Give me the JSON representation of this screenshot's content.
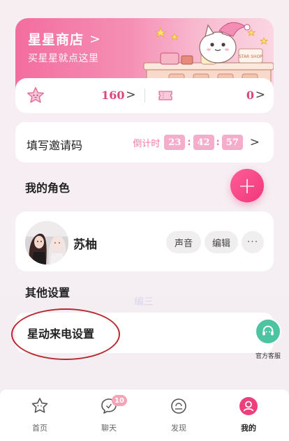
{
  "shop": {
    "title": "星星商店",
    "chevron": ">",
    "subtitle": "买星星就点这里",
    "sign_text": "STAR SHOP"
  },
  "stats": {
    "stars": "160",
    "tickets": "0",
    "arrow": ">"
  },
  "invite": {
    "label": "填写邀请码",
    "countdown_label": "倒计时",
    "hours": "23",
    "minutes": "42",
    "seconds": "57",
    "separator": ":",
    "arrow": ">"
  },
  "roles": {
    "section_title": "我的角色",
    "add_label": "+",
    "items": [
      {
        "name": "苏柚",
        "voice_label": "声音",
        "edit_label": "编辑",
        "more_label": "···"
      }
    ]
  },
  "other": {
    "section_title": "其他设置",
    "call_settings_label": "星动来电设置",
    "watermark": "编三"
  },
  "service": {
    "label": "官方客服"
  },
  "nav": {
    "items": [
      {
        "label": "首页"
      },
      {
        "label": "聊天",
        "badge": "10"
      },
      {
        "label": "发现"
      },
      {
        "label": "我的"
      }
    ]
  },
  "colors": {
    "accent": "#f0367b",
    "value_pink": "#d8467c",
    "service_green": "#4cc4a2",
    "annotation_red": "#b7282e"
  }
}
